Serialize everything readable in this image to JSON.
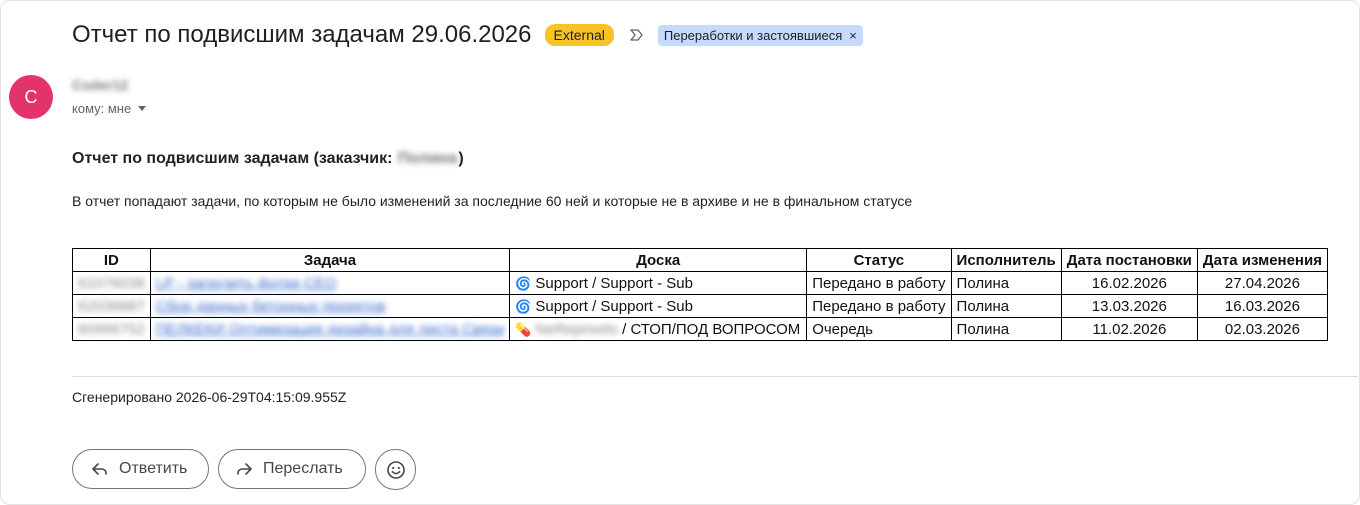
{
  "email": {
    "subject": "Отчет по подвисшим задачам 29.06.2026",
    "external_badge": "External",
    "label_chip": "Переработки и застоявшиеся",
    "label_chip_close": "×",
    "sender_initial": "C",
    "sender_name": "Coder12",
    "to_text": "кому: мне"
  },
  "body": {
    "heading_prefix": "Отчет по подвисшим задачам (заказчик:",
    "heading_customer": "Полина",
    "heading_suffix": ")",
    "description": "В отчет попадают задачи, по которым не было изменений за последние 60 ней и которые не в архиве и не в финальном статусе",
    "table": {
      "headers": [
        "ID",
        "Задача",
        "Доска",
        "Статус",
        "Исполнитель",
        "Дата постановки",
        "Дата изменения"
      ],
      "rows": [
        {
          "id": "61076038",
          "task": "LP - загрузить фотки СЕО",
          "board_icon": "🌀",
          "board_prefix": "",
          "board": "Support / Support - Sub",
          "status": "Передано в работу",
          "assignee": "Полина",
          "created": "16.02.2026",
          "changed": "27.04.2026"
        },
        {
          "id": "62036887",
          "task": "Сбор данных бетонных проектов",
          "board_icon": "🌀",
          "board_prefix": "",
          "board": "Support / Support - Sub",
          "status": "Передано в работу",
          "assignee": "Полина",
          "created": "13.03.2026",
          "changed": "16.03.2026"
        },
        {
          "id": "60966752",
          "task": "ПЕЛКЕКИ Оптимизация дизайна для листа Связи",
          "board_icon": "💊",
          "board_prefix": "NeReprivelo",
          "board": "/ СТОП/ПОД ВОПРОСОМ",
          "status": "Очередь",
          "assignee": "Полина",
          "created": "11.02.2026",
          "changed": "02.03.2026"
        }
      ]
    },
    "footer": "Сгенерировано 2026-06-29T04:15:09.955Z"
  },
  "actions": {
    "reply_label": "Ответить",
    "forward_label": "Переслать"
  },
  "colors": {
    "external_badge": "#f8c328",
    "label_chip": "#c6dafc",
    "avatar": "#e2336b",
    "link": "#3366cc"
  }
}
